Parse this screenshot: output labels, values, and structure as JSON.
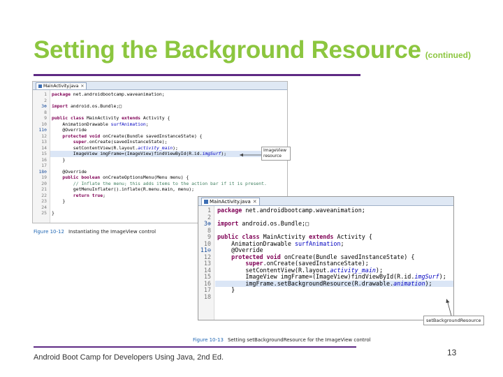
{
  "slide": {
    "title": "Setting the Background Resource",
    "title_suffix": "(continued)",
    "footer": "Android Boot Camp for Developers Using Java, 2nd Ed.",
    "page_number": "13",
    "colors": {
      "title": "#8cc63f",
      "rule": "#5e2a84",
      "caption_label": "#1f66b3"
    }
  },
  "figure1": {
    "tab_label": "MainActivity.java",
    "caption_label": "Figure 10-12",
    "caption_text": "Instantiating the ImageView control",
    "callout": "ImageView\nresource",
    "lines": [
      {
        "n": "1",
        "t": "package net.androidbootcamp.waveanimation;"
      },
      {
        "n": "2",
        "t": ""
      },
      {
        "n": "3⊕",
        "t": "import android.os.Bundle;□"
      },
      {
        "n": "8",
        "t": ""
      },
      {
        "n": "9",
        "t": "public class MainActivity extends Activity {"
      },
      {
        "n": "10",
        "t": "    AnimationDrawable surfAnimation;"
      },
      {
        "n": "11⊖",
        "t": "    @Override"
      },
      {
        "n": "12",
        "t": "    protected void onCreate(Bundle savedInstanceState) {"
      },
      {
        "n": "13",
        "t": "        super.onCreate(savedInstanceState);"
      },
      {
        "n": "14",
        "t": "        setContentView(R.layout.activity_main);"
      },
      {
        "n": "15",
        "t": "        ImageView imgFrame=(ImageView)findViewById(R.id.imgSurf);"
      },
      {
        "n": "16",
        "t": "    }"
      },
      {
        "n": "17",
        "t": ""
      },
      {
        "n": "18⊖",
        "t": "    @Override"
      },
      {
        "n": "19",
        "t": "    public boolean onCreateOptionsMenu(Menu menu) {"
      },
      {
        "n": "20",
        "t": "        // Inflate the menu; this adds items to the action bar if it is present."
      },
      {
        "n": "21",
        "t": "        getMenuInflater().inflate(R.menu.main, menu);"
      },
      {
        "n": "22",
        "t": "        return true;"
      },
      {
        "n": "23",
        "t": "    }"
      },
      {
        "n": "24",
        "t": ""
      },
      {
        "n": "25",
        "t": "}"
      }
    ]
  },
  "figure2": {
    "tab_label": "MainActivity.java",
    "caption_label": "Figure 10-13",
    "caption_text": "Setting setBackgroundResource for the ImageView control",
    "callout": "setBackgroundResource",
    "lines": [
      {
        "n": "1",
        "t": "package net.androidbootcamp.waveanimation;"
      },
      {
        "n": "2",
        "t": ""
      },
      {
        "n": "3⊕",
        "t": "import android.os.Bundle;□"
      },
      {
        "n": "8",
        "t": ""
      },
      {
        "n": "9",
        "t": "public class MainActivity extends Activity {"
      },
      {
        "n": "10",
        "t": "    AnimationDrawable surfAnimation;"
      },
      {
        "n": "11⊖",
        "t": "    @Override"
      },
      {
        "n": "12",
        "t": "    protected void onCreate(Bundle savedInstanceState) {"
      },
      {
        "n": "13",
        "t": "        super.onCreate(savedInstanceState);"
      },
      {
        "n": "14",
        "t": "        setContentView(R.layout.activity_main);"
      },
      {
        "n": "15",
        "t": "        ImageView imgFrame=(ImageView)findViewById(R.id.imgSurf);"
      },
      {
        "n": "16",
        "t": "        imgFrame.setBackgroundResource(R.drawable.animation);"
      },
      {
        "n": "17",
        "t": "    }"
      },
      {
        "n": "18",
        "t": ""
      }
    ]
  }
}
